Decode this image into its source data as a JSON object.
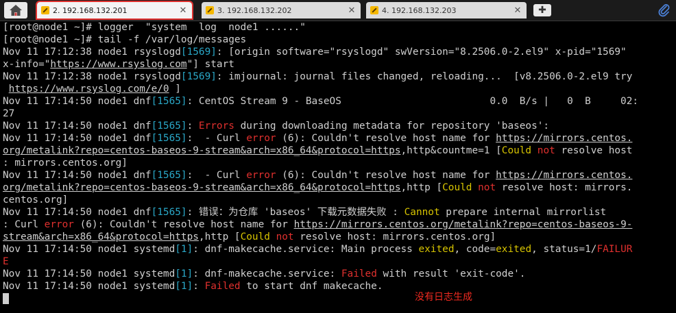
{
  "tabs": [
    {
      "label": "2. 192.168.132.201",
      "active": true
    },
    {
      "label": "3. 192.168.132.202",
      "active": false
    },
    {
      "label": "4. 192.168.132.203",
      "active": false
    }
  ],
  "terminal": {
    "lines": [
      [
        [
          "[root@node1 ~]# logger  \"system  log  node1 ......\"",
          ""
        ]
      ],
      [
        [
          "[root@node1 ~]# tail -f /var/log/messages",
          ""
        ]
      ],
      [
        [
          "Nov 11 17:12:38 node1 rsyslogd",
          ""
        ],
        [
          "[1569]",
          "pid"
        ],
        [
          ": [origin software=\"rsyslogd\" swVersion=\"8.2506.0-2.el9\" x-pid=\"1569\"",
          ""
        ]
      ],
      [
        [
          "x-info=\"",
          ""
        ],
        [
          "https://www.rsyslog.com",
          "link"
        ],
        [
          "\"] start",
          ""
        ]
      ],
      [
        [
          "Nov 11 17:12:38 node1 rsyslogd",
          ""
        ],
        [
          "[1569]",
          "pid"
        ],
        [
          ": imjournal: journal files changed, reloading...  [v8.2506.0-2.el9 try",
          ""
        ]
      ],
      [
        [
          " ",
          ""
        ],
        [
          "https://www.rsyslog.com/e/0",
          "link"
        ],
        [
          " ]",
          ""
        ]
      ],
      [
        [
          "Nov 11 17:14:50 node1 dnf",
          ""
        ],
        [
          "[1565]",
          "pid"
        ],
        [
          ": CentOS Stream 9 - BaseOS                         0.0  B/s |   0  B     02:",
          ""
        ]
      ],
      [
        [
          "27",
          ""
        ]
      ],
      [
        [
          "Nov 11 17:14:50 node1 dnf",
          ""
        ],
        [
          "[1565]",
          "pid"
        ],
        [
          ": ",
          ""
        ],
        [
          "Errors",
          "red"
        ],
        [
          " during downloading metadata for repository 'baseos':",
          ""
        ]
      ],
      [
        [
          "Nov 11 17:14:50 node1 dnf",
          ""
        ],
        [
          "[1565]",
          "pid"
        ],
        [
          ":  - Curl ",
          ""
        ],
        [
          "error",
          "red"
        ],
        [
          " (6): Couldn't resolve host name for ",
          ""
        ],
        [
          "https://mirrors.centos.",
          "link"
        ]
      ],
      [
        [
          "org/metalink?repo=centos-baseos-9-stream&arch=x86_64&protocol=https",
          "link"
        ],
        [
          ",http&countme=1 [",
          ""
        ],
        [
          "Could",
          "yel"
        ],
        [
          " ",
          ""
        ],
        [
          "not",
          "red"
        ],
        [
          " resolve host",
          ""
        ]
      ],
      [
        [
          ": mirrors.centos.org]",
          ""
        ]
      ],
      [
        [
          "Nov 11 17:14:50 node1 dnf",
          ""
        ],
        [
          "[1565]",
          "pid"
        ],
        [
          ":  - Curl ",
          ""
        ],
        [
          "error",
          "red"
        ],
        [
          " (6): Couldn't resolve host name for ",
          ""
        ],
        [
          "https://mirrors.centos.",
          "link"
        ]
      ],
      [
        [
          "org/metalink?repo=centos-baseos-9-stream&arch=x86_64&protocol=https",
          "link"
        ],
        [
          ",http [",
          ""
        ],
        [
          "Could",
          "yel"
        ],
        [
          " ",
          ""
        ],
        [
          "not",
          "red"
        ],
        [
          " resolve host: mirrors.",
          ""
        ]
      ],
      [
        [
          "centos.org]",
          ""
        ]
      ],
      [
        [
          "Nov 11 17:14:50 node1 dnf",
          ""
        ],
        [
          "[1565]",
          "pid"
        ],
        [
          ": 错误：为仓库 'baseos' 下载元数据失败 : ",
          ""
        ],
        [
          "Cannot",
          "yel"
        ],
        [
          " prepare internal mirrorlist",
          ""
        ]
      ],
      [
        [
          ": Curl ",
          ""
        ],
        [
          "error",
          "red"
        ],
        [
          " (6): Couldn't resolve host name for ",
          ""
        ],
        [
          "https://mirrors.centos.org/metalink?repo=centos-baseos-9-",
          "link"
        ]
      ],
      [
        [
          "stream&arch=x86_64&protocol=https",
          "link"
        ],
        [
          ",http [",
          ""
        ],
        [
          "Could",
          "yel"
        ],
        [
          " ",
          ""
        ],
        [
          "not",
          "red"
        ],
        [
          " resolve host: mirrors.centos.org]",
          ""
        ]
      ],
      [
        [
          "Nov 11 17:14:50 node1 systemd",
          ""
        ],
        [
          "[1]",
          "pid"
        ],
        [
          ": dnf-makecache.service: Main process ",
          ""
        ],
        [
          "exited",
          "yel"
        ],
        [
          ", code=",
          ""
        ],
        [
          "exited",
          "yel"
        ],
        [
          ", status=1/",
          ""
        ],
        [
          "FAILUR",
          "red"
        ]
      ],
      [
        [
          "E",
          "red"
        ]
      ],
      [
        [
          "Nov 11 17:14:50 node1 systemd",
          ""
        ],
        [
          "[1]",
          "pid"
        ],
        [
          ": dnf-makecache.service: ",
          ""
        ],
        [
          "Failed",
          "red"
        ],
        [
          " with result 'exit-code'.",
          ""
        ]
      ],
      [
        [
          "Nov 11 17:14:50 node1 systemd",
          ""
        ],
        [
          "[1]",
          "pid"
        ],
        [
          ": ",
          ""
        ],
        [
          "Failed",
          "red"
        ],
        [
          " to start dnf makecache.",
          ""
        ]
      ]
    ]
  },
  "annotation": "没有日志生成",
  "colors": {
    "pid": "#2aa8c8",
    "red": "#e0302e",
    "yellow": "#d7c400",
    "annotation": "#f02a20",
    "tab_outline": "#e0312f"
  },
  "icons": {
    "home": "home-icon",
    "tab": "pencil-icon",
    "new_tab": "plus-icon",
    "attach": "paperclip-icon"
  }
}
